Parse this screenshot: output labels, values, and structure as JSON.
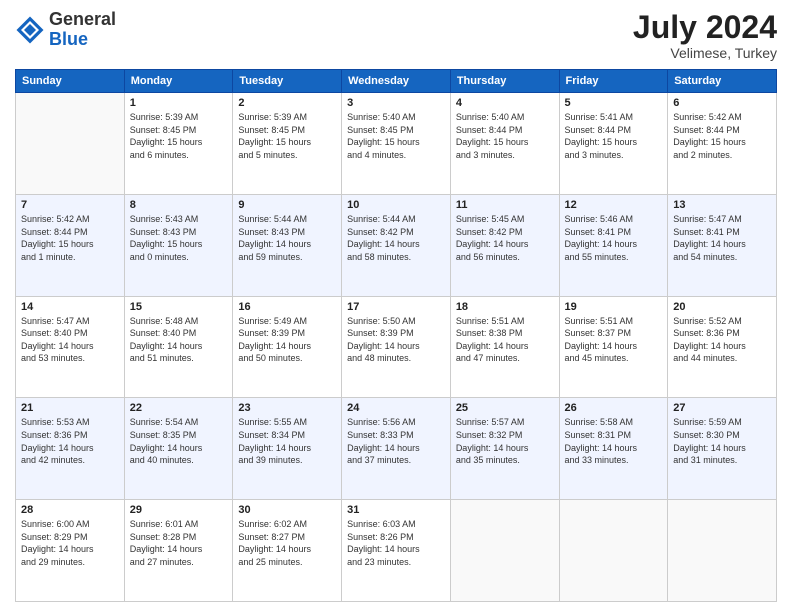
{
  "header": {
    "logo_general": "General",
    "logo_blue": "Blue",
    "month_year": "July 2024",
    "location": "Velimese, Turkey"
  },
  "weekdays": [
    "Sunday",
    "Monday",
    "Tuesday",
    "Wednesday",
    "Thursday",
    "Friday",
    "Saturday"
  ],
  "weeks": [
    {
      "shade": "row-white",
      "days": [
        {
          "num": "",
          "detail": ""
        },
        {
          "num": "1",
          "detail": "Sunrise: 5:39 AM\nSunset: 8:45 PM\nDaylight: 15 hours\nand 6 minutes."
        },
        {
          "num": "2",
          "detail": "Sunrise: 5:39 AM\nSunset: 8:45 PM\nDaylight: 15 hours\nand 5 minutes."
        },
        {
          "num": "3",
          "detail": "Sunrise: 5:40 AM\nSunset: 8:45 PM\nDaylight: 15 hours\nand 4 minutes."
        },
        {
          "num": "4",
          "detail": "Sunrise: 5:40 AM\nSunset: 8:44 PM\nDaylight: 15 hours\nand 3 minutes."
        },
        {
          "num": "5",
          "detail": "Sunrise: 5:41 AM\nSunset: 8:44 PM\nDaylight: 15 hours\nand 3 minutes."
        },
        {
          "num": "6",
          "detail": "Sunrise: 5:42 AM\nSunset: 8:44 PM\nDaylight: 15 hours\nand 2 minutes."
        }
      ]
    },
    {
      "shade": "row-shaded",
      "days": [
        {
          "num": "7",
          "detail": "Sunrise: 5:42 AM\nSunset: 8:44 PM\nDaylight: 15 hours\nand 1 minute."
        },
        {
          "num": "8",
          "detail": "Sunrise: 5:43 AM\nSunset: 8:43 PM\nDaylight: 15 hours\nand 0 minutes."
        },
        {
          "num": "9",
          "detail": "Sunrise: 5:44 AM\nSunset: 8:43 PM\nDaylight: 14 hours\nand 59 minutes."
        },
        {
          "num": "10",
          "detail": "Sunrise: 5:44 AM\nSunset: 8:42 PM\nDaylight: 14 hours\nand 58 minutes."
        },
        {
          "num": "11",
          "detail": "Sunrise: 5:45 AM\nSunset: 8:42 PM\nDaylight: 14 hours\nand 56 minutes."
        },
        {
          "num": "12",
          "detail": "Sunrise: 5:46 AM\nSunset: 8:41 PM\nDaylight: 14 hours\nand 55 minutes."
        },
        {
          "num": "13",
          "detail": "Sunrise: 5:47 AM\nSunset: 8:41 PM\nDaylight: 14 hours\nand 54 minutes."
        }
      ]
    },
    {
      "shade": "row-white",
      "days": [
        {
          "num": "14",
          "detail": "Sunrise: 5:47 AM\nSunset: 8:40 PM\nDaylight: 14 hours\nand 53 minutes."
        },
        {
          "num": "15",
          "detail": "Sunrise: 5:48 AM\nSunset: 8:40 PM\nDaylight: 14 hours\nand 51 minutes."
        },
        {
          "num": "16",
          "detail": "Sunrise: 5:49 AM\nSunset: 8:39 PM\nDaylight: 14 hours\nand 50 minutes."
        },
        {
          "num": "17",
          "detail": "Sunrise: 5:50 AM\nSunset: 8:39 PM\nDaylight: 14 hours\nand 48 minutes."
        },
        {
          "num": "18",
          "detail": "Sunrise: 5:51 AM\nSunset: 8:38 PM\nDaylight: 14 hours\nand 47 minutes."
        },
        {
          "num": "19",
          "detail": "Sunrise: 5:51 AM\nSunset: 8:37 PM\nDaylight: 14 hours\nand 45 minutes."
        },
        {
          "num": "20",
          "detail": "Sunrise: 5:52 AM\nSunset: 8:36 PM\nDaylight: 14 hours\nand 44 minutes."
        }
      ]
    },
    {
      "shade": "row-shaded",
      "days": [
        {
          "num": "21",
          "detail": "Sunrise: 5:53 AM\nSunset: 8:36 PM\nDaylight: 14 hours\nand 42 minutes."
        },
        {
          "num": "22",
          "detail": "Sunrise: 5:54 AM\nSunset: 8:35 PM\nDaylight: 14 hours\nand 40 minutes."
        },
        {
          "num": "23",
          "detail": "Sunrise: 5:55 AM\nSunset: 8:34 PM\nDaylight: 14 hours\nand 39 minutes."
        },
        {
          "num": "24",
          "detail": "Sunrise: 5:56 AM\nSunset: 8:33 PM\nDaylight: 14 hours\nand 37 minutes."
        },
        {
          "num": "25",
          "detail": "Sunrise: 5:57 AM\nSunset: 8:32 PM\nDaylight: 14 hours\nand 35 minutes."
        },
        {
          "num": "26",
          "detail": "Sunrise: 5:58 AM\nSunset: 8:31 PM\nDaylight: 14 hours\nand 33 minutes."
        },
        {
          "num": "27",
          "detail": "Sunrise: 5:59 AM\nSunset: 8:30 PM\nDaylight: 14 hours\nand 31 minutes."
        }
      ]
    },
    {
      "shade": "row-white",
      "days": [
        {
          "num": "28",
          "detail": "Sunrise: 6:00 AM\nSunset: 8:29 PM\nDaylight: 14 hours\nand 29 minutes."
        },
        {
          "num": "29",
          "detail": "Sunrise: 6:01 AM\nSunset: 8:28 PM\nDaylight: 14 hours\nand 27 minutes."
        },
        {
          "num": "30",
          "detail": "Sunrise: 6:02 AM\nSunset: 8:27 PM\nDaylight: 14 hours\nand 25 minutes."
        },
        {
          "num": "31",
          "detail": "Sunrise: 6:03 AM\nSunset: 8:26 PM\nDaylight: 14 hours\nand 23 minutes."
        },
        {
          "num": "",
          "detail": ""
        },
        {
          "num": "",
          "detail": ""
        },
        {
          "num": "",
          "detail": ""
        }
      ]
    }
  ]
}
